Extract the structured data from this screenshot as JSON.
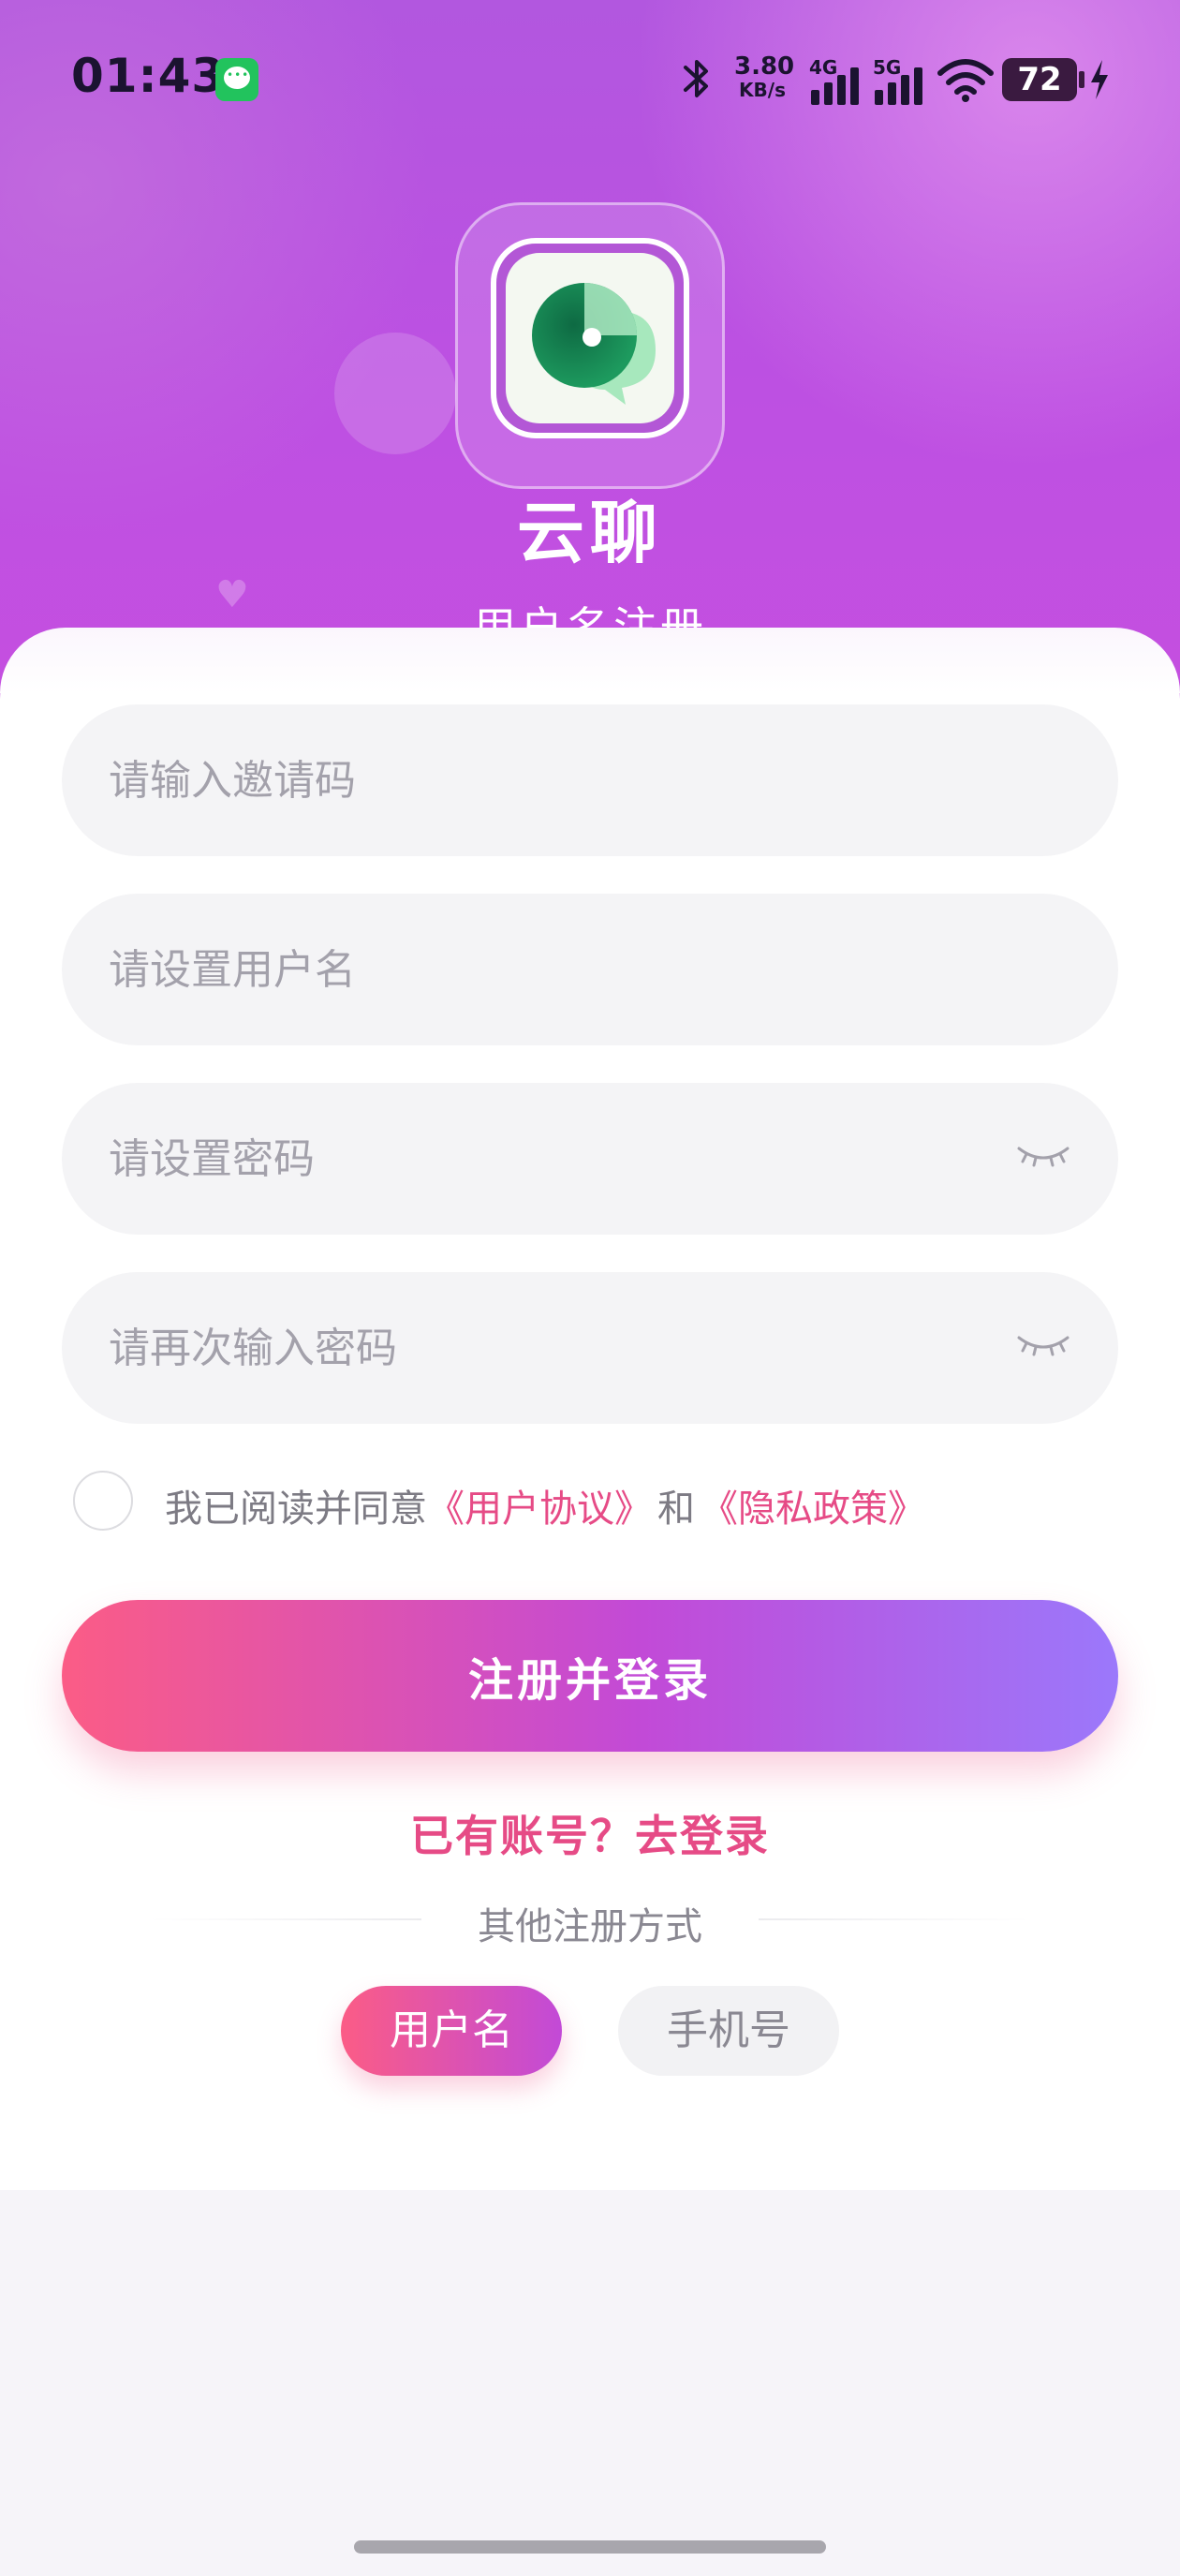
{
  "status_bar": {
    "time": "01:43",
    "net_speed_value": "3.80",
    "net_speed_unit": "KB/s",
    "signal_1_label": "4G",
    "signal_2_label": "5G",
    "battery": "72"
  },
  "app": {
    "name": "云聊",
    "subtitle": "用户名注册"
  },
  "form": {
    "invite_code_placeholder": "请输入邀请码",
    "username_placeholder": "请设置用户名",
    "password_placeholder": "请设置密码",
    "confirm_password_placeholder": "请再次输入密码",
    "agree_prefix": "我已阅读并同意",
    "user_agreement": "《用户协议》",
    "agree_and": "和",
    "privacy_policy": "《隐私政策》",
    "submit_label": "注册并登录",
    "login_link": "已有账号？去登录",
    "other_methods_label": "其他注册方式",
    "method_username": "用户名",
    "method_phone": "手机号"
  },
  "colors": {
    "accent_pink": "#e64b86",
    "gradient_start": "#fb5c86",
    "gradient_mid": "#c24ad7",
    "gradient_end": "#9b78fb",
    "header_purple": "#b257df"
  }
}
